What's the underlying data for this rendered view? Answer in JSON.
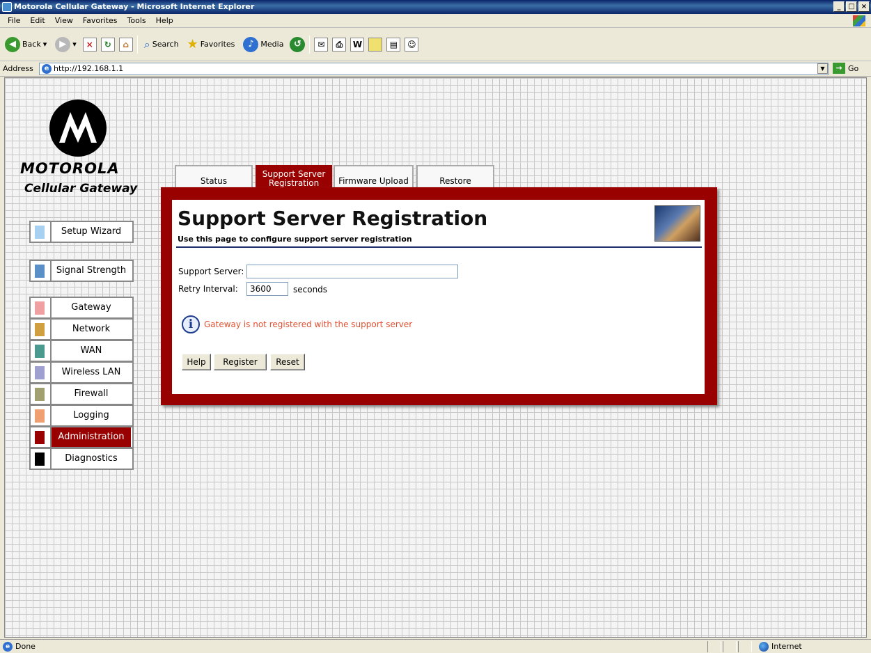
{
  "window": {
    "title": "Motorola Cellular Gateway - Microsoft Internet Explorer"
  },
  "menu": [
    "File",
    "Edit",
    "View",
    "Favorites",
    "Tools",
    "Help"
  ],
  "toolbar": {
    "back": "Back",
    "search": "Search",
    "favorites": "Favorites",
    "media": "Media"
  },
  "address": {
    "label": "Address",
    "url": "http://192.168.1.1",
    "go": "Go"
  },
  "brand": {
    "name": "MOTOROLA",
    "product": "Cellular Gateway"
  },
  "nav": [
    {
      "label": "Setup Wizard",
      "color": "#a8d0f0"
    },
    {
      "label": "Signal Strength",
      "color": "#5a8fc8"
    },
    {
      "label": "Gateway",
      "color": "#f0a0a0"
    },
    {
      "label": "Network",
      "color": "#d0a040"
    },
    {
      "label": "WAN",
      "color": "#4a9a90"
    },
    {
      "label": "Wireless LAN",
      "color": "#a0a0d0"
    },
    {
      "label": "Firewall",
      "color": "#a0a070"
    },
    {
      "label": "Logging",
      "color": "#f0a070"
    },
    {
      "label": "Administration",
      "color": "#990000"
    },
    {
      "label": "Diagnostics",
      "color": "#000000"
    }
  ],
  "tabs": {
    "status": "Status",
    "registration_l1": "Support Server",
    "registration_l2": "Registration",
    "firmware": "Firmware Upload",
    "restore": "Restore"
  },
  "panel": {
    "title": "Support Server Registration",
    "subtitle": "Use this page to configure support server registration",
    "server_label": "Support Server:",
    "server_value": "",
    "retry_label": "Retry Interval:",
    "retry_value": "3600",
    "retry_unit": "seconds",
    "message": "Gateway is not registered with the support server",
    "help": "Help",
    "register": "Register",
    "reset": "Reset"
  },
  "status": {
    "left": "Done",
    "zone": "Internet"
  },
  "colors": {
    "accent": "#990000",
    "message": "#e05030"
  }
}
